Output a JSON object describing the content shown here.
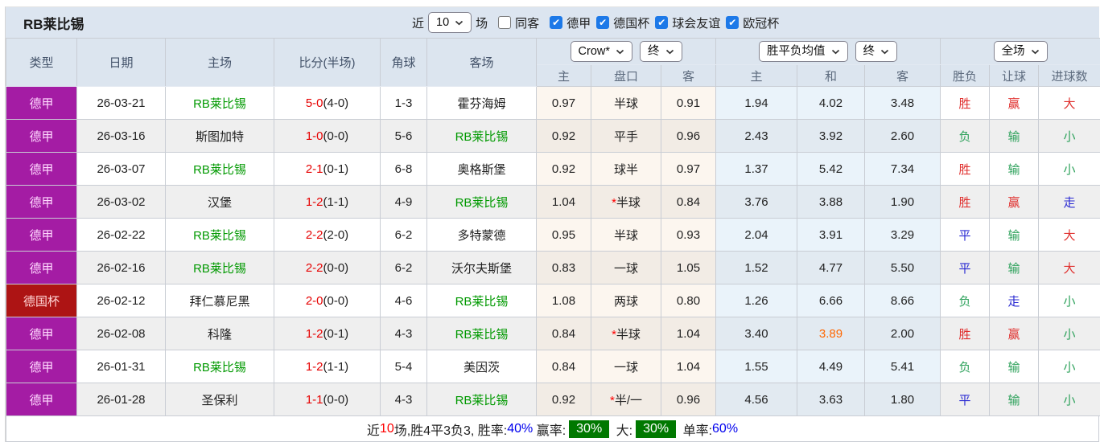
{
  "title": "RB莱比锡",
  "controls": {
    "recent_label": "近",
    "recent_select": "10",
    "games_label": "场",
    "same_away": {
      "label": "同客",
      "checked": false
    },
    "leagues": [
      {
        "label": "德甲",
        "checked": true
      },
      {
        "label": "德国杯",
        "checked": true
      },
      {
        "label": "球会友谊",
        "checked": true
      },
      {
        "label": "欧冠杯",
        "checked": true
      }
    ]
  },
  "header": {
    "columns": [
      "类型",
      "日期",
      "主场",
      "比分(半场)",
      "角球",
      "客场"
    ],
    "company_select": "Crow*",
    "company_time_select": "终",
    "avg_select": "胜平负均值",
    "avg_time_select": "终",
    "scope_select": "全场",
    "sub_columns": [
      "主",
      "盘口",
      "客",
      "主",
      "和",
      "客",
      "胜负",
      "让球",
      "进球数"
    ]
  },
  "rows": [
    {
      "league": "德甲",
      "league_bg": "#A41CA4",
      "league_fg": "#ffd9ff",
      "date": "26-03-21",
      "home": "RB莱比锡",
      "home_green": true,
      "score": "5-0",
      "half": "(4-0)",
      "corners": "1-3",
      "away": "霍芬海姆",
      "away_green": false,
      "crow_home": "0.97",
      "handicap": "半球",
      "star": false,
      "crow_away": "0.91",
      "avg_home": "1.94",
      "avg_draw": "4.02",
      "avg_draw_hl": false,
      "avg_away": "3.48",
      "wdl": {
        "t": "胜",
        "c": "r"
      },
      "let": {
        "t": "赢",
        "c": "r"
      },
      "goals": {
        "t": "大",
        "c": "r"
      }
    },
    {
      "league": "德甲",
      "league_bg": "#A41CA4",
      "league_fg": "#ffd9ff",
      "date": "26-03-16",
      "home": "斯图加特",
      "home_green": false,
      "score": "1-0",
      "half": "(0-0)",
      "corners": "5-6",
      "away": "RB莱比锡",
      "away_green": true,
      "crow_home": "0.92",
      "handicap": "平手",
      "star": false,
      "crow_away": "0.96",
      "avg_home": "2.43",
      "avg_draw": "3.92",
      "avg_draw_hl": false,
      "avg_away": "2.60",
      "wdl": {
        "t": "负",
        "c": "g"
      },
      "let": {
        "t": "输",
        "c": "g"
      },
      "goals": {
        "t": "小",
        "c": "g"
      }
    },
    {
      "league": "德甲",
      "league_bg": "#A41CA4",
      "league_fg": "#ffd9ff",
      "date": "26-03-07",
      "home": "RB莱比锡",
      "home_green": true,
      "score": "2-1",
      "half": "(0-1)",
      "corners": "6-8",
      "away": "奥格斯堡",
      "away_green": false,
      "crow_home": "0.92",
      "handicap": "球半",
      "star": false,
      "crow_away": "0.97",
      "avg_home": "1.37",
      "avg_draw": "5.42",
      "avg_draw_hl": false,
      "avg_away": "7.34",
      "wdl": {
        "t": "胜",
        "c": "r"
      },
      "let": {
        "t": "输",
        "c": "g"
      },
      "goals": {
        "t": "小",
        "c": "g"
      }
    },
    {
      "league": "德甲",
      "league_bg": "#A41CA4",
      "league_fg": "#ffd9ff",
      "date": "26-03-02",
      "home": "汉堡",
      "home_green": false,
      "score": "1-2",
      "half": "(1-1)",
      "corners": "4-9",
      "away": "RB莱比锡",
      "away_green": true,
      "crow_home": "1.04",
      "handicap": "半球",
      "star": true,
      "crow_away": "0.84",
      "avg_home": "3.76",
      "avg_draw": "3.88",
      "avg_draw_hl": false,
      "avg_away": "1.90",
      "wdl": {
        "t": "胜",
        "c": "r"
      },
      "let": {
        "t": "赢",
        "c": "r"
      },
      "goals": {
        "t": "走",
        "c": "b"
      }
    },
    {
      "league": "德甲",
      "league_bg": "#A41CA4",
      "league_fg": "#ffd9ff",
      "date": "26-02-22",
      "home": "RB莱比锡",
      "home_green": true,
      "score": "2-2",
      "half": "(2-0)",
      "corners": "6-2",
      "away": "多特蒙德",
      "away_green": false,
      "crow_home": "0.95",
      "handicap": "半球",
      "star": false,
      "crow_away": "0.93",
      "avg_home": "2.04",
      "avg_draw": "3.91",
      "avg_draw_hl": false,
      "avg_away": "3.29",
      "wdl": {
        "t": "平",
        "c": "b"
      },
      "let": {
        "t": "输",
        "c": "g"
      },
      "goals": {
        "t": "大",
        "c": "r"
      }
    },
    {
      "league": "德甲",
      "league_bg": "#A41CA4",
      "league_fg": "#ffd9ff",
      "date": "26-02-16",
      "home": "RB莱比锡",
      "home_green": true,
      "score": "2-2",
      "half": "(0-0)",
      "corners": "6-2",
      "away": "沃尔夫斯堡",
      "away_green": false,
      "crow_home": "0.83",
      "handicap": "一球",
      "star": false,
      "crow_away": "1.05",
      "avg_home": "1.52",
      "avg_draw": "4.77",
      "avg_draw_hl": false,
      "avg_away": "5.50",
      "wdl": {
        "t": "平",
        "c": "b"
      },
      "let": {
        "t": "输",
        "c": "g"
      },
      "goals": {
        "t": "大",
        "c": "r"
      }
    },
    {
      "league": "德国杯",
      "league_bg": "#AD1414",
      "league_fg": "#ffd6d6",
      "date": "26-02-12",
      "home": "拜仁慕尼黑",
      "home_green": false,
      "score": "2-0",
      "half": "(0-0)",
      "corners": "4-6",
      "away": "RB莱比锡",
      "away_green": true,
      "crow_home": "1.08",
      "handicap": "两球",
      "star": false,
      "crow_away": "0.80",
      "avg_home": "1.26",
      "avg_draw": "6.66",
      "avg_draw_hl": false,
      "avg_away": "8.66",
      "wdl": {
        "t": "负",
        "c": "g"
      },
      "let": {
        "t": "走",
        "c": "b"
      },
      "goals": {
        "t": "小",
        "c": "g"
      }
    },
    {
      "league": "德甲",
      "league_bg": "#A41CA4",
      "league_fg": "#ffd9ff",
      "date": "26-02-08",
      "home": "科隆",
      "home_green": false,
      "score": "1-2",
      "half": "(0-1)",
      "corners": "4-3",
      "away": "RB莱比锡",
      "away_green": true,
      "crow_home": "0.84",
      "handicap": "半球",
      "star": true,
      "crow_away": "1.04",
      "avg_home": "3.40",
      "avg_draw": "3.89",
      "avg_draw_hl": true,
      "avg_away": "2.00",
      "wdl": {
        "t": "胜",
        "c": "r"
      },
      "let": {
        "t": "赢",
        "c": "r"
      },
      "goals": {
        "t": "小",
        "c": "g"
      }
    },
    {
      "league": "德甲",
      "league_bg": "#A41CA4",
      "league_fg": "#ffd9ff",
      "date": "26-01-31",
      "home": "RB莱比锡",
      "home_green": true,
      "score": "1-2",
      "half": "(1-1)",
      "corners": "5-4",
      "away": "美因茨",
      "away_green": false,
      "crow_home": "0.84",
      "handicap": "一球",
      "star": false,
      "crow_away": "1.04",
      "avg_home": "1.55",
      "avg_draw": "4.49",
      "avg_draw_hl": false,
      "avg_away": "5.41",
      "wdl": {
        "t": "负",
        "c": "g"
      },
      "let": {
        "t": "输",
        "c": "g"
      },
      "goals": {
        "t": "小",
        "c": "g"
      }
    },
    {
      "league": "德甲",
      "league_bg": "#A41CA4",
      "league_fg": "#ffd9ff",
      "date": "26-01-28",
      "home": "圣保利",
      "home_green": false,
      "score": "1-1",
      "half": "(0-0)",
      "corners": "4-3",
      "away": "RB莱比锡",
      "away_green": true,
      "crow_home": "0.92",
      "handicap": "半/一",
      "star": true,
      "crow_away": "0.96",
      "avg_home": "4.56",
      "avg_draw": "3.63",
      "avg_draw_hl": false,
      "avg_away": "1.80",
      "wdl": {
        "t": "平",
        "c": "b"
      },
      "let": {
        "t": "输",
        "c": "g"
      },
      "goals": {
        "t": "小",
        "c": "g"
      }
    }
  ],
  "footer": {
    "segments": [
      {
        "t": "近",
        "c": "plain"
      },
      {
        "t": "10",
        "c": "red"
      },
      {
        "t": "场,胜4平3负3, 胜率:",
        "c": "plain"
      },
      {
        "t": "40%",
        "c": "blue"
      },
      {
        "t": " 赢率:",
        "c": "plain"
      },
      {
        "t": "30%",
        "c": "greenbox"
      },
      {
        "t": " 大:",
        "c": "plain"
      },
      {
        "t": "30%",
        "c": "greenbox"
      },
      {
        "t": " 单率:",
        "c": "plain"
      },
      {
        "t": "60%",
        "c": "blue"
      }
    ]
  }
}
